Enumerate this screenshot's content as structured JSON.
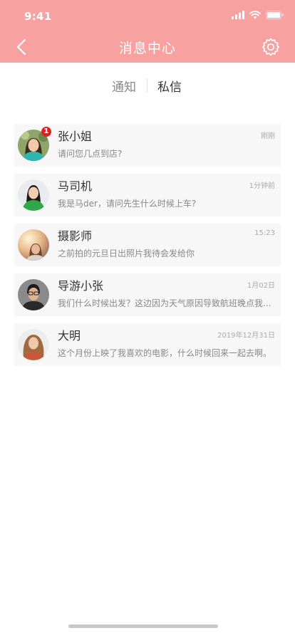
{
  "status_bar": {
    "time": "9:41"
  },
  "header": {
    "title": "消息中心",
    "back_icon": "back-arrow-icon",
    "settings_icon": "gear-icon",
    "color": "#f7a1a1"
  },
  "tabs": [
    {
      "label": "通知",
      "active": false
    },
    {
      "label": "私信",
      "active": true
    }
  ],
  "messages": [
    {
      "name": "张小姐",
      "time": "刚刚",
      "preview": "请问您几点到店?",
      "badge": "1"
    },
    {
      "name": "马司机",
      "time": "1分钟前",
      "preview": "我是马der，请问先生什么时候上车?"
    },
    {
      "name": "摄影师",
      "time": "15:23",
      "preview": "之前拍的元旦日出照片我待会发给你"
    },
    {
      "name": "导游小张",
      "time": "1月02日",
      "preview": "我们什么时候出发？这边因为天气原因导致航班晚点我..."
    },
    {
      "name": "大明",
      "time": "2019年12月31日",
      "preview": "这个月份上映了我喜欢的电影，什么时候回来一起去啊。"
    }
  ],
  "colors": {
    "badge": "#e02020",
    "card": "#f7f7f7"
  }
}
